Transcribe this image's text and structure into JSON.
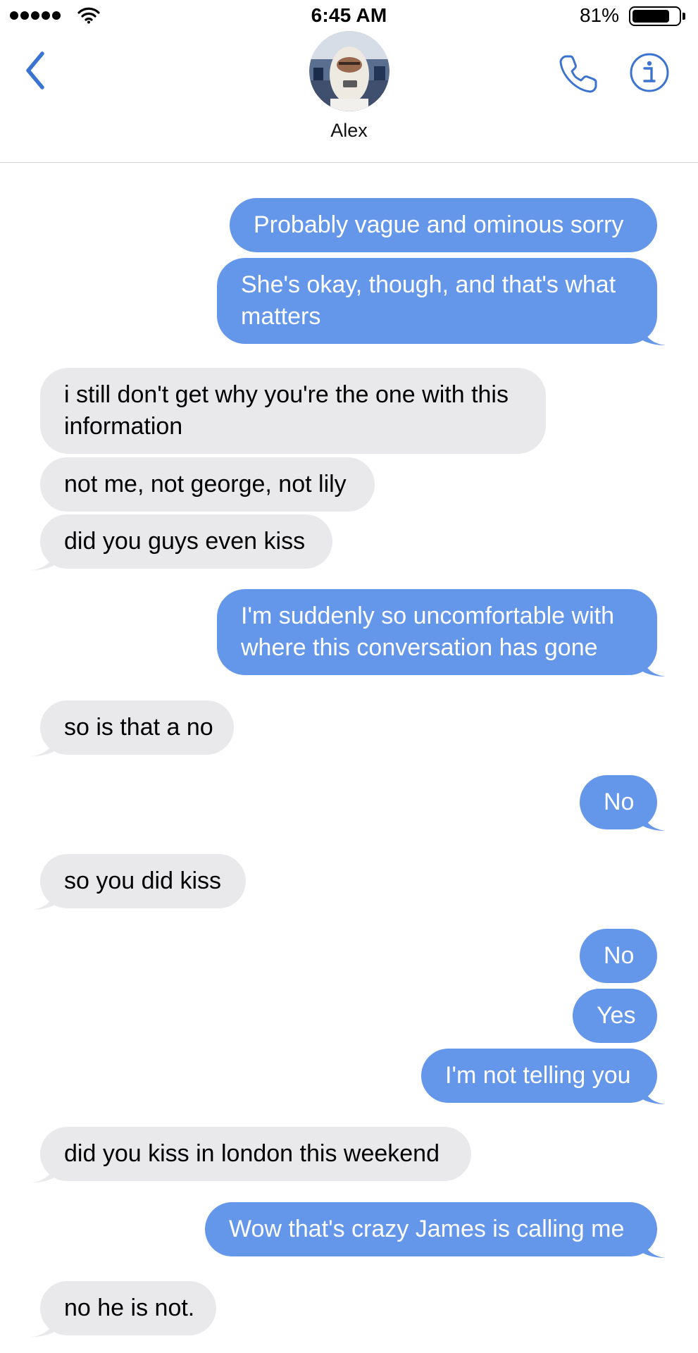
{
  "status_bar": {
    "time": "6:45 AM",
    "battery_percent": "81%",
    "battery_level": 0.81,
    "signal_bars": 5
  },
  "header": {
    "contact_name": "Alex",
    "accent_color": "#3b73d1"
  },
  "messages": [
    {
      "direction": "sent",
      "text": "Probably vague and ominous sorry"
    },
    {
      "direction": "sent",
      "text": "She's okay, though, and that's what matters"
    },
    {
      "direction": "received",
      "text": "i still don't get why you're the one with this information"
    },
    {
      "direction": "received",
      "text": "not me, not george, not lily"
    },
    {
      "direction": "received",
      "text": "did you guys even kiss"
    },
    {
      "direction": "sent",
      "text": "I'm suddenly so uncomfortable with where this conversation has gone"
    },
    {
      "direction": "received",
      "text": "so is that a no"
    },
    {
      "direction": "sent",
      "text": "No"
    },
    {
      "direction": "received",
      "text": "so you did kiss"
    },
    {
      "direction": "sent",
      "text": "No"
    },
    {
      "direction": "sent",
      "text": "Yes"
    },
    {
      "direction": "sent",
      "text": "I'm not telling you"
    },
    {
      "direction": "received",
      "text": "did you kiss in london this weekend"
    },
    {
      "direction": "sent",
      "text": "Wow that's crazy James is calling me"
    },
    {
      "direction": "received",
      "text": "no he is not."
    }
  ],
  "colors": {
    "sent_bubble": "#6496ea",
    "received_bubble": "#e9e9ec"
  }
}
